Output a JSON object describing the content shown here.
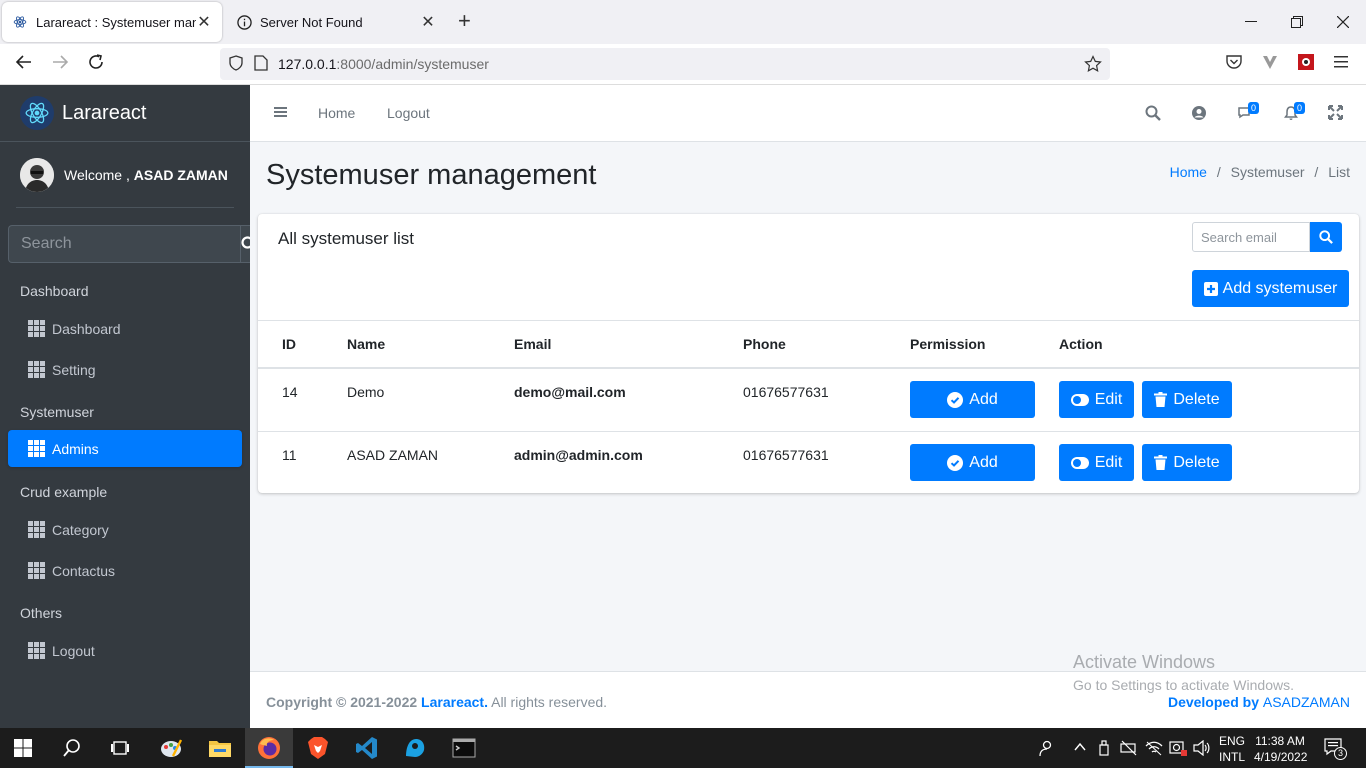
{
  "browser": {
    "tabs": [
      {
        "title": "Larareact : Systemuser management",
        "close": "✕"
      },
      {
        "title": "Server Not Found",
        "close": "✕"
      }
    ],
    "new_tab": "+",
    "url_host": "127.0.0.1",
    "url_path": ":8000/admin/systemuser"
  },
  "sidebar": {
    "brand": "Larareact",
    "welcome_prefix": "Welcome , ",
    "user_name": "ASAD ZAMAN",
    "search_placeholder": "Search",
    "sections": [
      {
        "header": "Dashboard",
        "items": [
          "Dashboard",
          "Setting"
        ]
      },
      {
        "header": "Systemuser",
        "items": [
          "Admins"
        ]
      },
      {
        "header": "Crud example",
        "items": [
          "Category",
          "Contactus"
        ]
      },
      {
        "header": "Others",
        "items": [
          "Logout"
        ]
      }
    ],
    "active_item": "Admins"
  },
  "topnav": {
    "links": [
      "Home",
      "Logout"
    ],
    "messages_count": "0",
    "notifications_count": "0"
  },
  "page": {
    "title": "Systemuser management",
    "breadcrumb": [
      "Home",
      "Systemuser",
      "List"
    ],
    "breadcrumb_sep": "/"
  },
  "card": {
    "title": "All systemuser list",
    "search_placeholder": "Search email",
    "add_button": "Add systemuser",
    "columns": [
      "ID",
      "Name",
      "Email",
      "Phone",
      "Permission",
      "Action"
    ],
    "rows": [
      {
        "id": "14",
        "name": "Demo",
        "email": "demo@mail.com",
        "phone": "01676577631"
      },
      {
        "id": "11",
        "name": "ASAD ZAMAN",
        "email": "admin@admin.com",
        "phone": "01676577631"
      }
    ],
    "permission_label": "Add",
    "edit_label": "Edit",
    "delete_label": "Delete"
  },
  "footer": {
    "copyright": "Copyright © 2021-2022 ",
    "brand": "Larareact.",
    "rights": " All rights reserved.",
    "developed_by": "Developed by ",
    "developer": "ASADZAMAN"
  },
  "watermark": {
    "line1": "Activate Windows",
    "line2": "Go to Settings to activate Windows."
  },
  "taskbar": {
    "lang1": "ENG",
    "lang2": "INTL",
    "time": "11:38 AM",
    "date": "4/19/2022",
    "notif_count": "3"
  }
}
